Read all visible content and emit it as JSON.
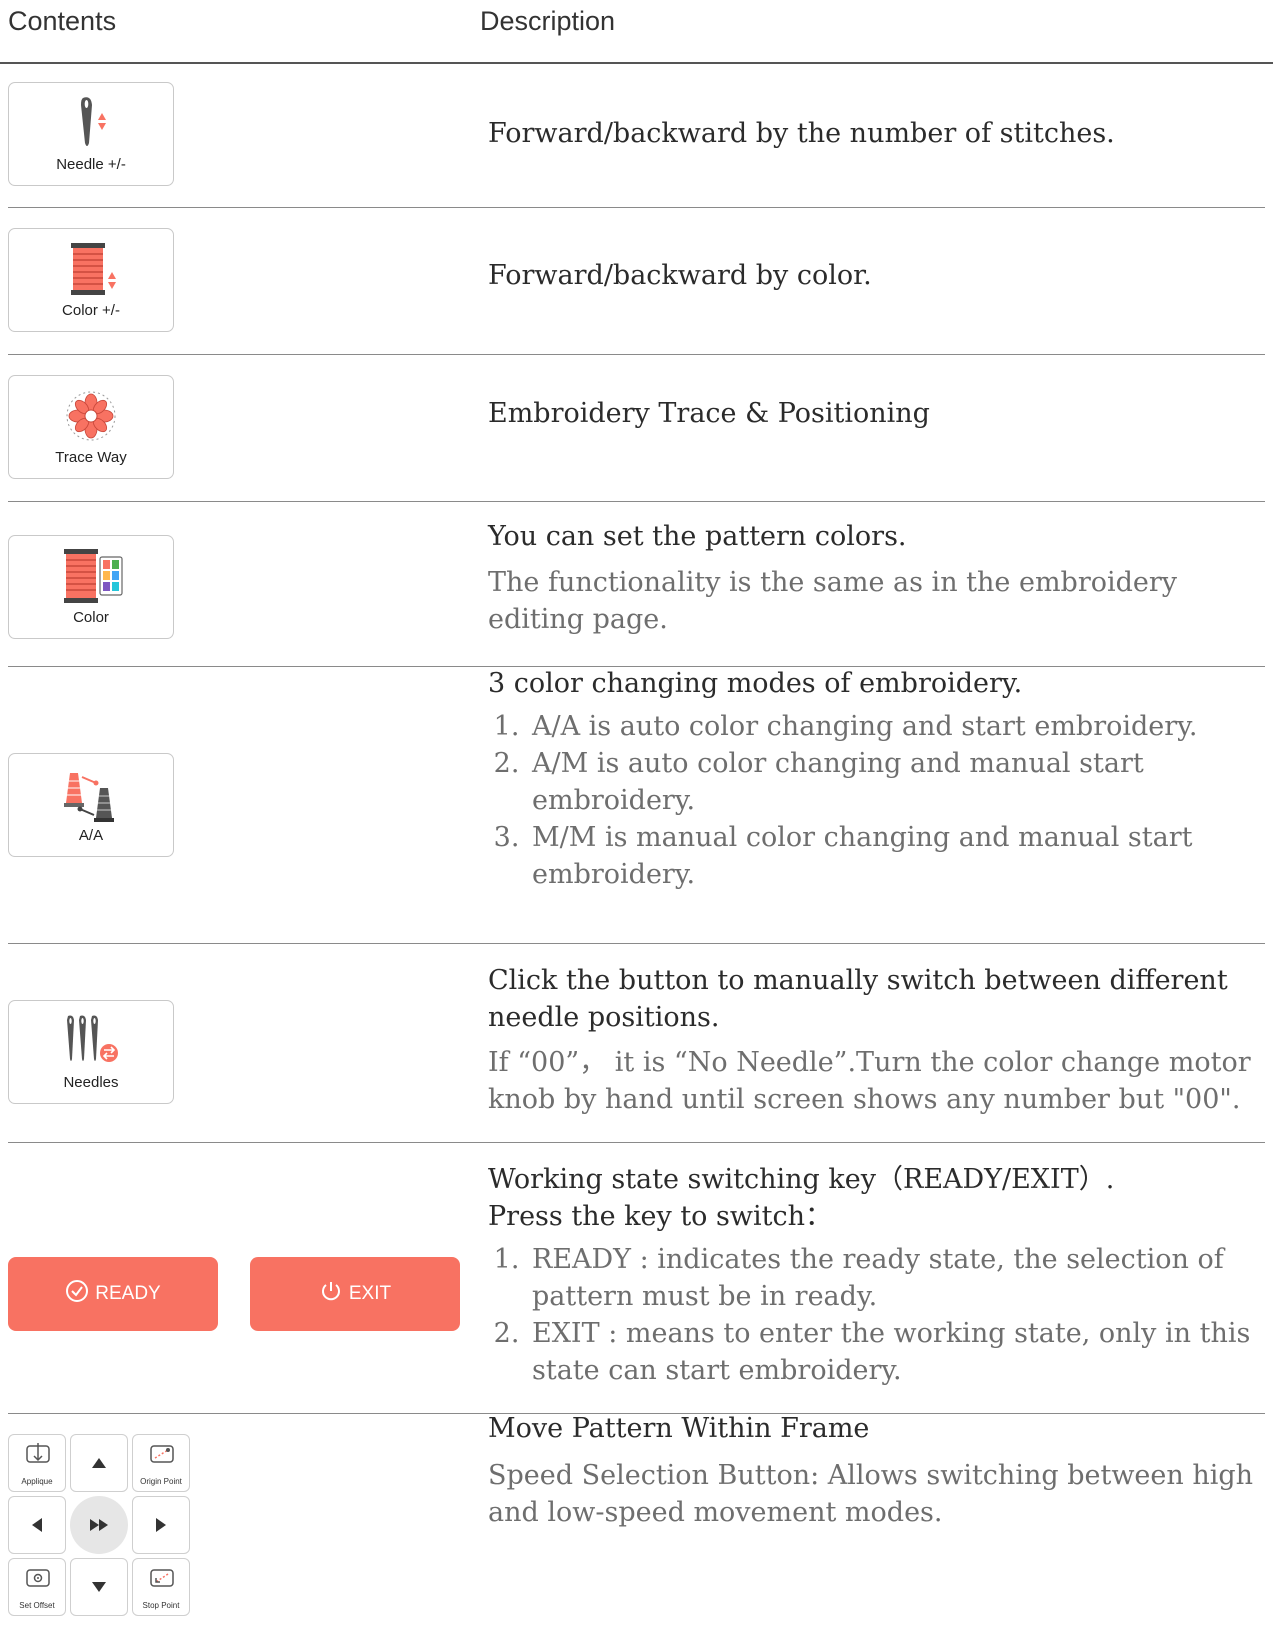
{
  "header": {
    "contents": "Contents",
    "description": "Description"
  },
  "rows": [
    {
      "label": "Needle +/-",
      "icon": "needle-updown-icon",
      "text": "Forward/backward by the number of stitches."
    },
    {
      "label": "Color +/-",
      "icon": "thread-spool-updown-icon",
      "text": "Forward/backward by color."
    },
    {
      "label": "Trace Way",
      "icon": "flower-trace-icon",
      "text": "Embroidery Trace & Positioning"
    },
    {
      "label": "Color",
      "icon": "spool-palette-icon",
      "text": "You can set the pattern colors.",
      "sub": "The functionality is the same as in the embroidery editing page."
    },
    {
      "label": "A/A",
      "icon": "color-change-mode-icon",
      "text": "3 color changing modes of embroidery.",
      "items": [
        "A/A is auto color changing and start embroidery.",
        "A/M is auto color changing and manual start embroidery.",
        "M/M is manual color changing and manual start embroidery."
      ]
    },
    {
      "label": "Needles",
      "icon": "needles-switch-icon",
      "text": "Click the button to manually switch between different needle positions.",
      "sub": "If “00”， it is “No Needle”.Turn the color change motor knob by hand until screen shows any number but \"00\"."
    },
    {
      "ready": "READY",
      "exit": "EXIT",
      "text": "Working state switching key（READY/EXIT）.",
      "text2": "Press the key to switch：",
      "items": [
        "READY : indicates the ready state, the selection of pattern must be in ready.",
        "EXIT : means to enter the working state, only in this state can start embroidery."
      ]
    },
    {
      "pad": {
        "applique": "Applique",
        "origin": "Origin Point",
        "offset": "Set Offset",
        "stop": "Stop Point"
      },
      "text": "Move Pattern Within Frame",
      "sub": "Speed Selection Button: Allows switching between high and low-speed movement modes."
    }
  ],
  "colors": {
    "accent": "#f87262",
    "text": "#2b2b2b",
    "muted": "#6e6e6e"
  }
}
